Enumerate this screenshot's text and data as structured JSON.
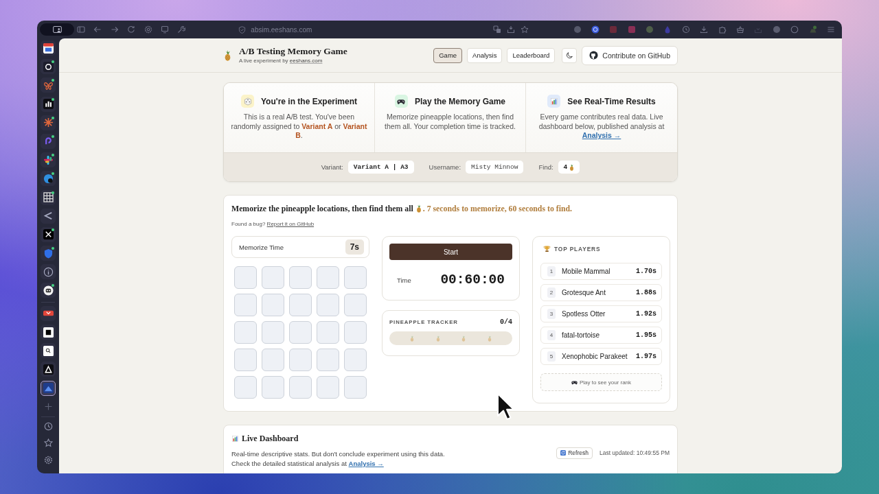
{
  "browser": {
    "url": "absim.eeshans.com"
  },
  "sidebar": {
    "groups": [
      {
        "apps": [
          {
            "selected": false,
            "notification": false
          },
          {
            "selected": false,
            "notification": true
          },
          {
            "selected": false,
            "notification": true
          },
          {
            "selected": false,
            "notification": true
          },
          {
            "selected": false,
            "notification": true
          },
          {
            "selected": false,
            "notification": true
          },
          {
            "selected": false,
            "notification": true
          },
          {
            "selected": false,
            "notification": true
          },
          {
            "selected": false,
            "notification": true
          },
          {
            "selected": false,
            "notification": false
          },
          {
            "selected": false,
            "notification": true
          },
          {
            "selected": false,
            "notification": true
          },
          {
            "selected": false,
            "notification": false
          },
          {
            "selected": false,
            "notification": true
          }
        ]
      },
      {
        "apps": [
          {
            "selected": false,
            "notification": false
          },
          {
            "selected": false,
            "notification": false
          },
          {
            "selected": false,
            "notification": false
          },
          {
            "selected": false,
            "notification": false
          },
          {
            "selected": true,
            "notification": false
          }
        ]
      }
    ]
  },
  "header": {
    "title": "A/B Testing Memory Game",
    "subtitle": "A live experiment by",
    "subtitle_link": "eeshans.com",
    "nav": [
      {
        "label": "Game",
        "selected": true
      },
      {
        "label": "Analysis",
        "selected": false
      },
      {
        "label": "Leaderboard",
        "selected": false
      }
    ],
    "github_button": "Contribute on GitHub"
  },
  "intro_cards": [
    {
      "title": "You're in the Experiment",
      "text": "This is a real A/B test. You've been randomly assigned to **Variant A** or **Variant B**.",
      "color": "#fbf3c9"
    },
    {
      "title": "Play the Memory Game",
      "text": "Memorize pineapple locations, then find them all. Your completion time is tracked.",
      "color": "#d9f5e2"
    },
    {
      "title": "See Real-Time Results",
      "text": "Every game contributes real data. Live dashboard below, published analysis at",
      "link": "Analysis →",
      "color": "#e0eafa"
    }
  ],
  "session": [
    {
      "kind": "text",
      "label": "Variant:",
      "value": "Variant A | A3",
      "bold": true
    },
    {
      "kind": "text",
      "label": "Username:",
      "value": "Misty Minnow",
      "bold": false
    },
    {
      "kind": "count",
      "label": "Find:",
      "value": "4",
      "bold": true
    }
  ],
  "game": {
    "title": "Memorize the pineapple locations, then find them all",
    "rules": ". 7 seconds to memorize, 60 seconds to find.",
    "bug_prompt": "Found a bug?",
    "bug_link": "Report it on GitHub",
    "memorize": {
      "label": "Memorize Time",
      "value": "7s"
    },
    "tiles": [
      {
        "revealed": false
      },
      {
        "revealed": false
      },
      {
        "revealed": false
      },
      {
        "revealed": false
      },
      {
        "revealed": false
      },
      {
        "revealed": false
      },
      {
        "revealed": false
      },
      {
        "revealed": false
      },
      {
        "revealed": false
      },
      {
        "revealed": false
      },
      {
        "revealed": false
      },
      {
        "revealed": false
      },
      {
        "revealed": false
      },
      {
        "revealed": false
      },
      {
        "revealed": false
      },
      {
        "revealed": false
      },
      {
        "revealed": false
      },
      {
        "revealed": false
      },
      {
        "revealed": false
      },
      {
        "revealed": false
      },
      {
        "revealed": false
      },
      {
        "revealed": false
      },
      {
        "revealed": false
      },
      {
        "revealed": false
      },
      {
        "revealed": false
      }
    ],
    "start_button": "Start",
    "time_label": "Time",
    "time_value": "00:60:00",
    "tracker": {
      "label": "PINEAPPLE TRACKER",
      "count": "0/4",
      "slots": [
        {
          "found": false
        },
        {
          "found": false
        },
        {
          "found": false
        },
        {
          "found": false
        }
      ]
    },
    "leaderboard": {
      "title": "TOP PLAYERS",
      "players": [
        {
          "rank": "1",
          "name": "Mobile Mammal",
          "time": "1.70s"
        },
        {
          "rank": "2",
          "name": "Grotesque Ant",
          "time": "1.88s"
        },
        {
          "rank": "3",
          "name": "Spotless Otter",
          "time": "1.92s"
        },
        {
          "rank": "4",
          "name": "fatal-tortoise",
          "time": "1.95s"
        },
        {
          "rank": "5",
          "name": "Xenophobic Parakeet",
          "time": "1.97s"
        }
      ],
      "prompt": "Play to see your rank"
    }
  },
  "dashboard": {
    "title": "Live Dashboard",
    "description": "Real-time descriptive stats. But don't conclude experiment using this data.",
    "note": "Check the detailed statistical analysis at",
    "link": "Analysis →",
    "refresh_button": "Refresh",
    "last_updated": "Last updated: 10:49:55 PM"
  }
}
